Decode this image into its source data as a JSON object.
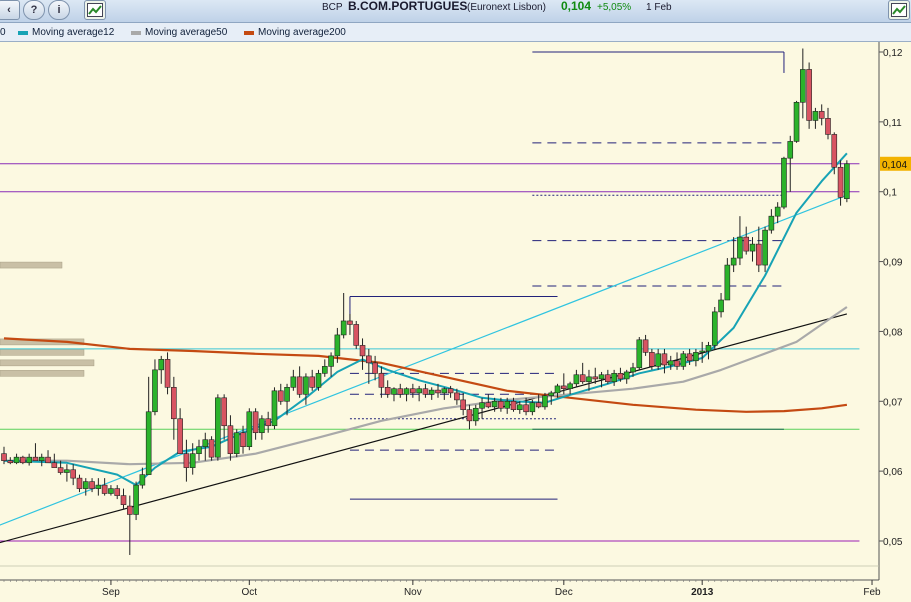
{
  "header": {
    "ticker": "BCP",
    "name": "B.COM.PORTUGUES",
    "exchange": "(Euronext Lisbon)",
    "last": "0,104",
    "change": "+5,05%",
    "date": "1 Feb",
    "help_icon": "help-icon",
    "info_icon": "info-icon",
    "chart_icon": "chart-icon"
  },
  "legend": {
    "ma12": "Moving average12",
    "ma50": "Moving average50",
    "ma200": "Moving average200"
  },
  "colors": {
    "ma12": "#17a3b5",
    "ma50": "#a9a9a9",
    "ma200": "#c44a12",
    "up": "#2bb32b",
    "down": "#d85462",
    "price_tag": "#f3b300",
    "change_green": "#108a10"
  },
  "chart_data": {
    "type": "candlestick",
    "ylim": [
      0.045,
      0.125
    ],
    "yticks": [
      "0,05",
      "0,06",
      "0,07",
      "0,08",
      "0,09",
      "0,1",
      "0,11",
      "0,12"
    ],
    "yticks_values": [
      0.05,
      0.06,
      0.07,
      0.08,
      0.09,
      0.1,
      0.11,
      0.12
    ],
    "xlabels": [
      "Sep",
      "Oct",
      "Nov",
      "Dec",
      "2013",
      "Feb"
    ],
    "xlabel_day": [
      17,
      39,
      65,
      89,
      111,
      138
    ],
    "last_price": 0.104,
    "last_label": "0,104",
    "candles": [
      [
        0,
        0.0625,
        0.0635,
        0.061,
        0.0615
      ],
      [
        1,
        0.0615,
        0.062,
        0.061,
        0.0612
      ],
      [
        2,
        0.0612,
        0.0625,
        0.061,
        0.062
      ],
      [
        3,
        0.062,
        0.0622,
        0.061,
        0.0612
      ],
      [
        4,
        0.0612,
        0.0625,
        0.0608,
        0.062
      ],
      [
        5,
        0.062,
        0.064,
        0.0618,
        0.0615
      ],
      [
        6,
        0.0615,
        0.0625,
        0.0607,
        0.062
      ],
      [
        7,
        0.062,
        0.063,
        0.0615,
        0.0612
      ],
      [
        8,
        0.0612,
        0.0625,
        0.0605,
        0.0605
      ],
      [
        9,
        0.0605,
        0.0615,
        0.0595,
        0.0598
      ],
      [
        10,
        0.0598,
        0.061,
        0.0585,
        0.0602
      ],
      [
        11,
        0.0602,
        0.061,
        0.058,
        0.059
      ],
      [
        12,
        0.059,
        0.0595,
        0.057,
        0.0575
      ],
      [
        13,
        0.0575,
        0.059,
        0.0565,
        0.0585
      ],
      [
        14,
        0.0585,
        0.059,
        0.057,
        0.0575
      ],
      [
        15,
        0.0575,
        0.059,
        0.0565,
        0.058
      ],
      [
        16,
        0.058,
        0.059,
        0.0565,
        0.0568
      ],
      [
        17,
        0.0568,
        0.058,
        0.0565,
        0.0575
      ],
      [
        18,
        0.0575,
        0.058,
        0.056,
        0.0565
      ],
      [
        19,
        0.0565,
        0.0575,
        0.0545,
        0.0552
      ],
      [
        20,
        0.055,
        0.0565,
        0.048,
        0.0538
      ],
      [
        21,
        0.0538,
        0.0585,
        0.053,
        0.058
      ],
      [
        22,
        0.058,
        0.0605,
        0.0575,
        0.0595
      ],
      [
        23,
        0.0595,
        0.0735,
        0.0595,
        0.0685
      ],
      [
        24,
        0.0685,
        0.076,
        0.068,
        0.0745
      ],
      [
        25,
        0.0745,
        0.0765,
        0.0725,
        0.076
      ],
      [
        26,
        0.076,
        0.077,
        0.071,
        0.072
      ],
      [
        27,
        0.072,
        0.0735,
        0.0645,
        0.0675
      ],
      [
        28,
        0.0675,
        0.069,
        0.0625,
        0.0625
      ],
      [
        29,
        0.0625,
        0.0645,
        0.0585,
        0.0605
      ],
      [
        30,
        0.0605,
        0.064,
        0.0595,
        0.0625
      ],
      [
        31,
        0.0625,
        0.0645,
        0.0615,
        0.0635
      ],
      [
        32,
        0.0635,
        0.0655,
        0.0615,
        0.0645
      ],
      [
        33,
        0.0645,
        0.065,
        0.0615,
        0.062
      ],
      [
        34,
        0.062,
        0.071,
        0.0615,
        0.0705
      ],
      [
        35,
        0.0705,
        0.071,
        0.0645,
        0.0665
      ],
      [
        36,
        0.0665,
        0.068,
        0.0615,
        0.0625
      ],
      [
        37,
        0.0625,
        0.066,
        0.062,
        0.0655
      ],
      [
        38,
        0.0655,
        0.0665,
        0.0625,
        0.0635
      ],
      [
        39,
        0.0635,
        0.069,
        0.063,
        0.0685
      ],
      [
        40,
        0.0685,
        0.069,
        0.0645,
        0.0655
      ],
      [
        41,
        0.0655,
        0.068,
        0.0645,
        0.0675
      ],
      [
        42,
        0.0675,
        0.0685,
        0.0655,
        0.0665
      ],
      [
        43,
        0.0665,
        0.072,
        0.066,
        0.0715
      ],
      [
        44,
        0.0715,
        0.0725,
        0.0695,
        0.07
      ],
      [
        45,
        0.07,
        0.0725,
        0.068,
        0.072
      ],
      [
        46,
        0.072,
        0.0745,
        0.0715,
        0.0735
      ],
      [
        47,
        0.0735,
        0.075,
        0.0705,
        0.071
      ],
      [
        48,
        0.071,
        0.074,
        0.0695,
        0.0735
      ],
      [
        49,
        0.0735,
        0.0745,
        0.0715,
        0.072
      ],
      [
        50,
        0.072,
        0.0745,
        0.0715,
        0.074
      ],
      [
        51,
        0.074,
        0.076,
        0.0735,
        0.075
      ],
      [
        52,
        0.075,
        0.077,
        0.0735,
        0.0765
      ],
      [
        53,
        0.0765,
        0.0805,
        0.0755,
        0.0795
      ],
      [
        54,
        0.0795,
        0.0855,
        0.079,
        0.0815
      ],
      [
        55,
        0.0815,
        0.0825,
        0.0795,
        0.081
      ],
      [
        56,
        0.081,
        0.0815,
        0.0775,
        0.078
      ],
      [
        57,
        0.078,
        0.079,
        0.0745,
        0.0765
      ],
      [
        58,
        0.0765,
        0.0775,
        0.0725,
        0.0755
      ],
      [
        59,
        0.0755,
        0.0765,
        0.073,
        0.074
      ],
      [
        60,
        0.074,
        0.075,
        0.0705,
        0.072
      ],
      [
        61,
        0.072,
        0.073,
        0.0705,
        0.071
      ],
      [
        62,
        0.071,
        0.072,
        0.07,
        0.0718
      ],
      [
        63,
        0.0718,
        0.0725,
        0.0705,
        0.071
      ],
      [
        64,
        0.071,
        0.072,
        0.07,
        0.0718
      ],
      [
        65,
        0.0718,
        0.0725,
        0.0705,
        0.0712
      ],
      [
        66,
        0.0712,
        0.0722,
        0.07,
        0.0718
      ],
      [
        67,
        0.0718,
        0.0725,
        0.0705,
        0.071
      ],
      [
        68,
        0.071,
        0.072,
        0.0702,
        0.0716
      ],
      [
        69,
        0.0716,
        0.0725,
        0.0705,
        0.0712
      ],
      [
        70,
        0.0712,
        0.072,
        0.0702,
        0.0718
      ],
      [
        71,
        0.0718,
        0.0722,
        0.0705,
        0.0712
      ],
      [
        72,
        0.0712,
        0.0718,
        0.0695,
        0.0702
      ],
      [
        73,
        0.0702,
        0.0712,
        0.068,
        0.0688
      ],
      [
        74,
        0.0688,
        0.0695,
        0.066,
        0.0672
      ],
      [
        75,
        0.0672,
        0.0695,
        0.0665,
        0.069
      ],
      [
        76,
        0.069,
        0.0705,
        0.0675,
        0.0698
      ],
      [
        77,
        0.0698,
        0.071,
        0.069,
        0.0692
      ],
      [
        78,
        0.0692,
        0.0705,
        0.0685,
        0.07
      ],
      [
        79,
        0.07,
        0.0705,
        0.0685,
        0.069
      ],
      [
        80,
        0.069,
        0.0705,
        0.0682,
        0.07
      ],
      [
        81,
        0.07,
        0.0705,
        0.0685,
        0.0688
      ],
      [
        82,
        0.0688,
        0.07,
        0.0682,
        0.0695
      ],
      [
        83,
        0.0695,
        0.0705,
        0.068,
        0.0685
      ],
      [
        84,
        0.0685,
        0.0702,
        0.068,
        0.0698
      ],
      [
        85,
        0.0698,
        0.071,
        0.069,
        0.0692
      ],
      [
        86,
        0.0692,
        0.0712,
        0.0688,
        0.0708
      ],
      [
        87,
        0.0708,
        0.0715,
        0.0695,
        0.0712
      ],
      [
        88,
        0.0712,
        0.0725,
        0.0705,
        0.0722
      ],
      [
        89,
        0.0722,
        0.074,
        0.071,
        0.0718
      ],
      [
        90,
        0.0718,
        0.0728,
        0.071,
        0.0725
      ],
      [
        91,
        0.0725,
        0.0745,
        0.072,
        0.0738
      ],
      [
        92,
        0.0738,
        0.0755,
        0.0725,
        0.0728
      ],
      [
        93,
        0.0728,
        0.0745,
        0.0715,
        0.0735
      ],
      [
        94,
        0.0735,
        0.0748,
        0.0725,
        0.0732
      ],
      [
        95,
        0.0732,
        0.0742,
        0.072,
        0.0738
      ],
      [
        96,
        0.0738,
        0.0745,
        0.0725,
        0.0728
      ],
      [
        97,
        0.0728,
        0.0745,
        0.0722,
        0.074
      ],
      [
        98,
        0.074,
        0.0748,
        0.0728,
        0.0732
      ],
      [
        99,
        0.0732,
        0.0745,
        0.0725,
        0.0742
      ],
      [
        100,
        0.0742,
        0.0755,
        0.0735,
        0.0748
      ],
      [
        101,
        0.0748,
        0.0792,
        0.0745,
        0.0788
      ],
      [
        102,
        0.0788,
        0.0795,
        0.0765,
        0.077
      ],
      [
        103,
        0.077,
        0.0775,
        0.0745,
        0.075
      ],
      [
        104,
        0.075,
        0.0775,
        0.0745,
        0.0768
      ],
      [
        105,
        0.0768,
        0.0775,
        0.074,
        0.0752
      ],
      [
        106,
        0.0752,
        0.0765,
        0.0745,
        0.0758
      ],
      [
        107,
        0.0758,
        0.077,
        0.0745,
        0.075
      ],
      [
        108,
        0.075,
        0.0772,
        0.0745,
        0.0768
      ],
      [
        109,
        0.0768,
        0.0775,
        0.0752,
        0.0758
      ],
      [
        110,
        0.0758,
        0.0775,
        0.075,
        0.077
      ],
      [
        111,
        0.077,
        0.0785,
        0.0755,
        0.0772
      ],
      [
        112,
        0.0772,
        0.0785,
        0.076,
        0.078
      ],
      [
        113,
        0.078,
        0.0835,
        0.0775,
        0.0828
      ],
      [
        114,
        0.0828,
        0.0855,
        0.082,
        0.0845
      ],
      [
        115,
        0.0845,
        0.0905,
        0.0845,
        0.0895
      ],
      [
        116,
        0.0895,
        0.0935,
        0.0885,
        0.0905
      ],
      [
        117,
        0.0905,
        0.0965,
        0.0895,
        0.0935
      ],
      [
        118,
        0.0935,
        0.095,
        0.091,
        0.0915
      ],
      [
        119,
        0.0915,
        0.0935,
        0.09,
        0.0925
      ],
      [
        120,
        0.0925,
        0.095,
        0.0885,
        0.0895
      ],
      [
        121,
        0.0895,
        0.095,
        0.0885,
        0.0945
      ],
      [
        122,
        0.0945,
        0.0975,
        0.094,
        0.0965
      ],
      [
        123,
        0.0965,
        0.0985,
        0.0955,
        0.0978
      ],
      [
        124,
        0.0978,
        0.105,
        0.0975,
        0.1048
      ],
      [
        125,
        0.1048,
        0.108,
        0.1,
        0.1072
      ],
      [
        126,
        0.1072,
        0.113,
        0.107,
        0.1128
      ],
      [
        127,
        0.1128,
        0.1205,
        0.1105,
        0.1175
      ],
      [
        128,
        0.1175,
        0.1185,
        0.109,
        0.1102
      ],
      [
        129,
        0.1102,
        0.112,
        0.109,
        0.1115
      ],
      [
        130,
        0.1115,
        0.1125,
        0.1095,
        0.1105
      ],
      [
        131,
        0.1105,
        0.112,
        0.1075,
        0.1082
      ],
      [
        132,
        0.1082,
        0.1085,
        0.1025,
        0.1035
      ],
      [
        133,
        0.1035,
        0.1045,
        0.098,
        0.0992
      ],
      [
        134,
        0.099,
        0.1045,
        0.0985,
        0.104
      ]
    ],
    "ma12": [
      [
        0,
        0.0615
      ],
      [
        10,
        0.0612
      ],
      [
        18,
        0.0595
      ],
      [
        21,
        0.058
      ],
      [
        24,
        0.0605
      ],
      [
        28,
        0.0628
      ],
      [
        33,
        0.0635
      ],
      [
        38,
        0.0655
      ],
      [
        43,
        0.0672
      ],
      [
        48,
        0.0705
      ],
      [
        53,
        0.0742
      ],
      [
        57,
        0.076
      ],
      [
        61,
        0.0745
      ],
      [
        66,
        0.073
      ],
      [
        71,
        0.0718
      ],
      [
        76,
        0.0705
      ],
      [
        81,
        0.07
      ],
      [
        86,
        0.0698
      ],
      [
        91,
        0.0712
      ],
      [
        96,
        0.0725
      ],
      [
        101,
        0.074
      ],
      [
        106,
        0.075
      ],
      [
        111,
        0.0762
      ],
      [
        116,
        0.0805
      ],
      [
        121,
        0.088
      ],
      [
        126,
        0.097
      ],
      [
        130,
        0.1015
      ],
      [
        134,
        0.1055
      ]
    ],
    "ma50": [
      [
        0,
        0.0615
      ],
      [
        10,
        0.0615
      ],
      [
        20,
        0.061
      ],
      [
        30,
        0.0612
      ],
      [
        40,
        0.0625
      ],
      [
        50,
        0.0648
      ],
      [
        60,
        0.0672
      ],
      [
        70,
        0.069
      ],
      [
        80,
        0.0702
      ],
      [
        90,
        0.071
      ],
      [
        100,
        0.0718
      ],
      [
        108,
        0.0728
      ],
      [
        114,
        0.0745
      ],
      [
        120,
        0.0765
      ],
      [
        126,
        0.0785
      ],
      [
        130,
        0.081
      ],
      [
        134,
        0.0835
      ]
    ],
    "ma200": [
      [
        0,
        0.079
      ],
      [
        10,
        0.0785
      ],
      [
        20,
        0.0775
      ],
      [
        30,
        0.0772
      ],
      [
        40,
        0.0768
      ],
      [
        50,
        0.0765
      ],
      [
        60,
        0.0755
      ],
      [
        70,
        0.0735
      ],
      [
        80,
        0.0715
      ],
      [
        90,
        0.0705
      ],
      [
        100,
        0.0695
      ],
      [
        110,
        0.0688
      ],
      [
        118,
        0.0685
      ],
      [
        124,
        0.0686
      ],
      [
        130,
        0.069
      ],
      [
        134,
        0.0695
      ]
    ],
    "uptrend_black": [
      [
        -10,
        0.0475
      ],
      [
        134,
        0.0825
      ]
    ],
    "uptrend_cyan": [
      [
        -20,
        0.0455
      ],
      [
        134,
        0.0995
      ]
    ],
    "hlines": [
      {
        "y": 0.104,
        "color": "#8a2db8",
        "from": -30,
        "to": 136,
        "style": "solid"
      },
      {
        "y": 0.1,
        "color": "#8a2db8",
        "from": -30,
        "to": 136,
        "style": "solid"
      },
      {
        "y": 0.0775,
        "color": "#3cc6d6",
        "from": -30,
        "to": 136,
        "style": "solid"
      },
      {
        "y": 0.066,
        "color": "#5ad15a",
        "from": -30,
        "to": 136,
        "style": "solid"
      },
      {
        "y": 0.066,
        "color": "#1b6b4f",
        "from": 84,
        "to": 124,
        "style": "solid"
      },
      {
        "y": 0.12,
        "color": "#22227a",
        "from": 84,
        "to": 124,
        "style": "solid"
      },
      {
        "y": 0.107,
        "color": "#22227a",
        "from": 84,
        "to": 124,
        "style": "dashed"
      },
      {
        "y": 0.0995,
        "color": "#22227a",
        "from": 84,
        "to": 124,
        "style": "dotted"
      },
      {
        "y": 0.093,
        "color": "#22227a",
        "from": 84,
        "to": 124,
        "style": "dashed"
      },
      {
        "y": 0.0865,
        "color": "#22227a",
        "from": 84,
        "to": 124,
        "style": "dashed"
      },
      {
        "y": 0.085,
        "color": "#22227a",
        "from": 55,
        "to": 88,
        "style": "solid"
      },
      {
        "y": 0.074,
        "color": "#22227a",
        "from": 55,
        "to": 88,
        "style": "dashed"
      },
      {
        "y": 0.071,
        "color": "#22227a",
        "from": 55,
        "to": 88,
        "style": "dashed"
      },
      {
        "y": 0.0675,
        "color": "#22227a",
        "from": 55,
        "to": 88,
        "style": "dotted"
      },
      {
        "y": 0.063,
        "color": "#22227a",
        "from": 55,
        "to": 88,
        "style": "dashed"
      },
      {
        "y": 0.056,
        "color": "#22227a",
        "from": 55,
        "to": 88,
        "style": "solid"
      },
      {
        "y": 0.05,
        "color": "#9b1fb5",
        "from": -30,
        "to": 136,
        "style": "solid"
      }
    ],
    "vlines": [
      {
        "x": 55,
        "y1": 0.085,
        "y2": 0.0815
      },
      {
        "x": 124,
        "y1": 0.12,
        "y2": 0.117
      }
    ],
    "volume_profile": [
      {
        "price": 0.0895,
        "size": 62
      },
      {
        "price": 0.0785,
        "size": 84
      },
      {
        "price": 0.077,
        "size": 84
      },
      {
        "price": 0.0755,
        "size": 94
      },
      {
        "price": 0.074,
        "size": 84
      }
    ]
  }
}
